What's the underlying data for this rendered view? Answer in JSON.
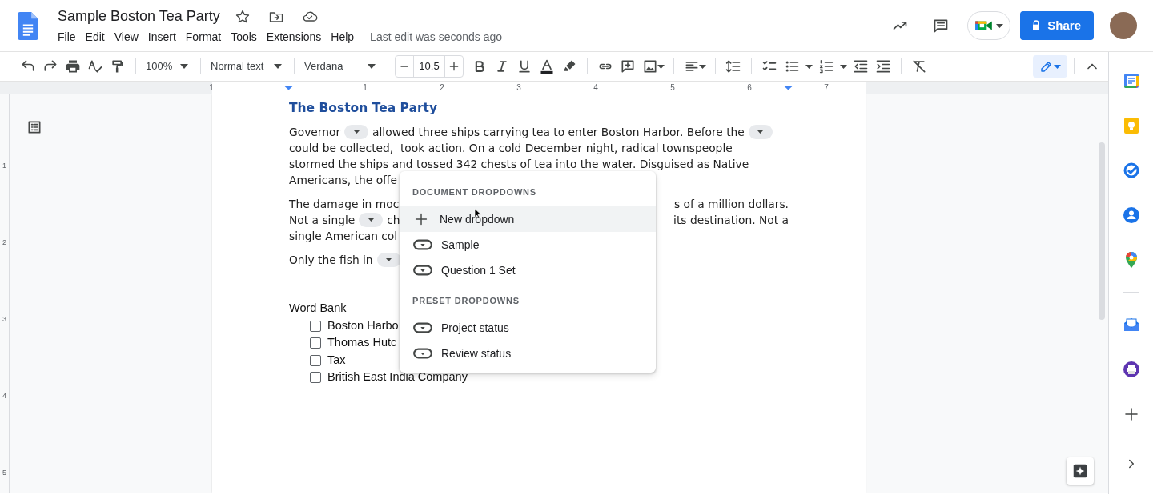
{
  "document_title": "Sample Boston Tea Party",
  "menu_bar": [
    "File",
    "Edit",
    "View",
    "Insert",
    "Format",
    "Tools",
    "Extensions",
    "Help"
  ],
  "last_edit": "Last edit was seconds ago",
  "share_button": "Share",
  "toolbar": {
    "zoom": "100%",
    "style": "Normal text",
    "font": "Verdana",
    "font_size": "10.5"
  },
  "ruler": {
    "horizontal": [
      "1",
      "1",
      "2",
      "3",
      "4",
      "5",
      "6",
      "7"
    ],
    "vertical": [
      "1",
      "2",
      "3",
      "4",
      "5"
    ]
  },
  "document": {
    "heading": "The Boston Tea Party",
    "paragraphs": [
      {
        "lines": [
          {
            "parts": [
              {
                "kind": "text",
                "text": "Governor"
              },
              {
                "kind": "chip"
              },
              {
                "kind": "text",
                "text": "allowed three ships carrying tea to enter Boston Harbor. Before the"
              },
              {
                "kind": "chip"
              }
            ]
          },
          {
            "parts": [
              {
                "kind": "text",
                "text": "could be collected,  took action. On a cold December night, radical townspeople"
              }
            ]
          },
          {
            "parts": [
              {
                "kind": "text",
                "text": "stormed the ships and tossed 342 chests of tea into the water. Disguised as Native"
              }
            ]
          },
          {
            "parts": [
              {
                "kind": "text",
                "text": "Americans, the offe"
              }
            ]
          }
        ]
      },
      {
        "lines": [
          {
            "parts": [
              {
                "kind": "text",
                "text": "The damage in moc"
              },
              {
                "kind": "gap"
              },
              {
                "kind": "text",
                "text": "s of a million dollars."
              }
            ]
          },
          {
            "parts": [
              {
                "kind": "text",
                "text": "Not a single"
              },
              {
                "kind": "chip"
              },
              {
                "kind": "text",
                "text": "ch"
              },
              {
                "kind": "gap"
              },
              {
                "kind": "text",
                "text": "its destination. Not a"
              }
            ]
          },
          {
            "parts": [
              {
                "kind": "text",
                "text": "single American col"
              }
            ]
          }
        ]
      },
      {
        "lines": [
          {
            "parts": [
              {
                "kind": "text",
                "text": "Only the fish in"
              },
              {
                "kind": "chip"
              }
            ]
          }
        ]
      }
    ],
    "word_bank": {
      "title": "Word Bank",
      "items": [
        {
          "label": "Boston Harbo",
          "checked": false
        },
        {
          "label": "Thomas Hutc",
          "checked": false
        },
        {
          "label": "Tax",
          "checked": false
        },
        {
          "label": "British East India Company",
          "checked": false
        }
      ]
    }
  },
  "dropdown_menu": {
    "sections": [
      {
        "heading": "DOCUMENT DROPDOWNS",
        "items": [
          {
            "kind": "add",
            "label": "New dropdown",
            "selected": true
          },
          {
            "kind": "dropdown",
            "label": "Sample",
            "selected": false
          },
          {
            "kind": "dropdown",
            "label": "Question 1 Set",
            "selected": false
          }
        ]
      },
      {
        "heading": "PRESET DROPDOWNS",
        "items": [
          {
            "kind": "dropdown",
            "label": "Project status",
            "selected": false
          },
          {
            "kind": "dropdown",
            "label": "Review status",
            "selected": false
          }
        ]
      }
    ]
  }
}
